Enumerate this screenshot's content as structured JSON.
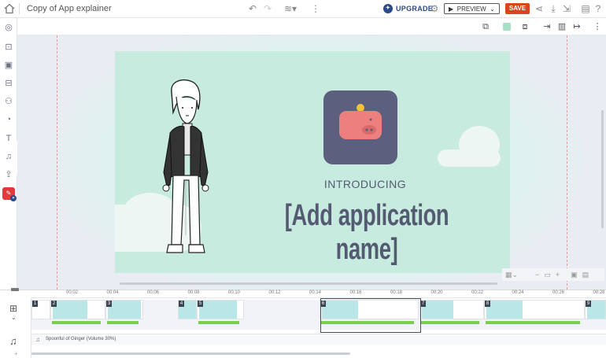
{
  "topbar": {
    "doc_title": "Copy of App explainer",
    "upgrade_label": "UPGRADE",
    "preview_label": "PREVIEW",
    "save_label": "SAVE"
  },
  "scene": {
    "introducing": "INTRODUCING",
    "app_name": "[Add application name]"
  },
  "timeline": {
    "ticks": [
      "00:02",
      "00:04",
      "00:06",
      "00:08",
      "00:10",
      "00:12",
      "00:14",
      "00:16",
      "00:18",
      "00:20",
      "00:22",
      "00:24",
      "00:26",
      "00:28"
    ],
    "audio_label": "Spoonful of Ginger (Volume 30%)",
    "clip_numbers": [
      "1",
      "2",
      "3",
      "4",
      "5",
      "6",
      "7",
      "8",
      "9"
    ]
  },
  "colors": {
    "save": "#d9461b",
    "accent": "#2b4a8a",
    "scene_bg": "#c7ebde",
    "text_purple": "#555a73",
    "timeline_green": "#7ccf4a"
  },
  "icons": {
    "home": "home-icon",
    "undo": "undo-icon",
    "redo": "redo-icon",
    "layers": "layers-icon",
    "more": "more-vertical-icon",
    "settings": "gear-icon",
    "share": "share-icon",
    "download": "download-icon",
    "export": "export-icon",
    "notes": "notes-icon",
    "help": "help-icon"
  }
}
